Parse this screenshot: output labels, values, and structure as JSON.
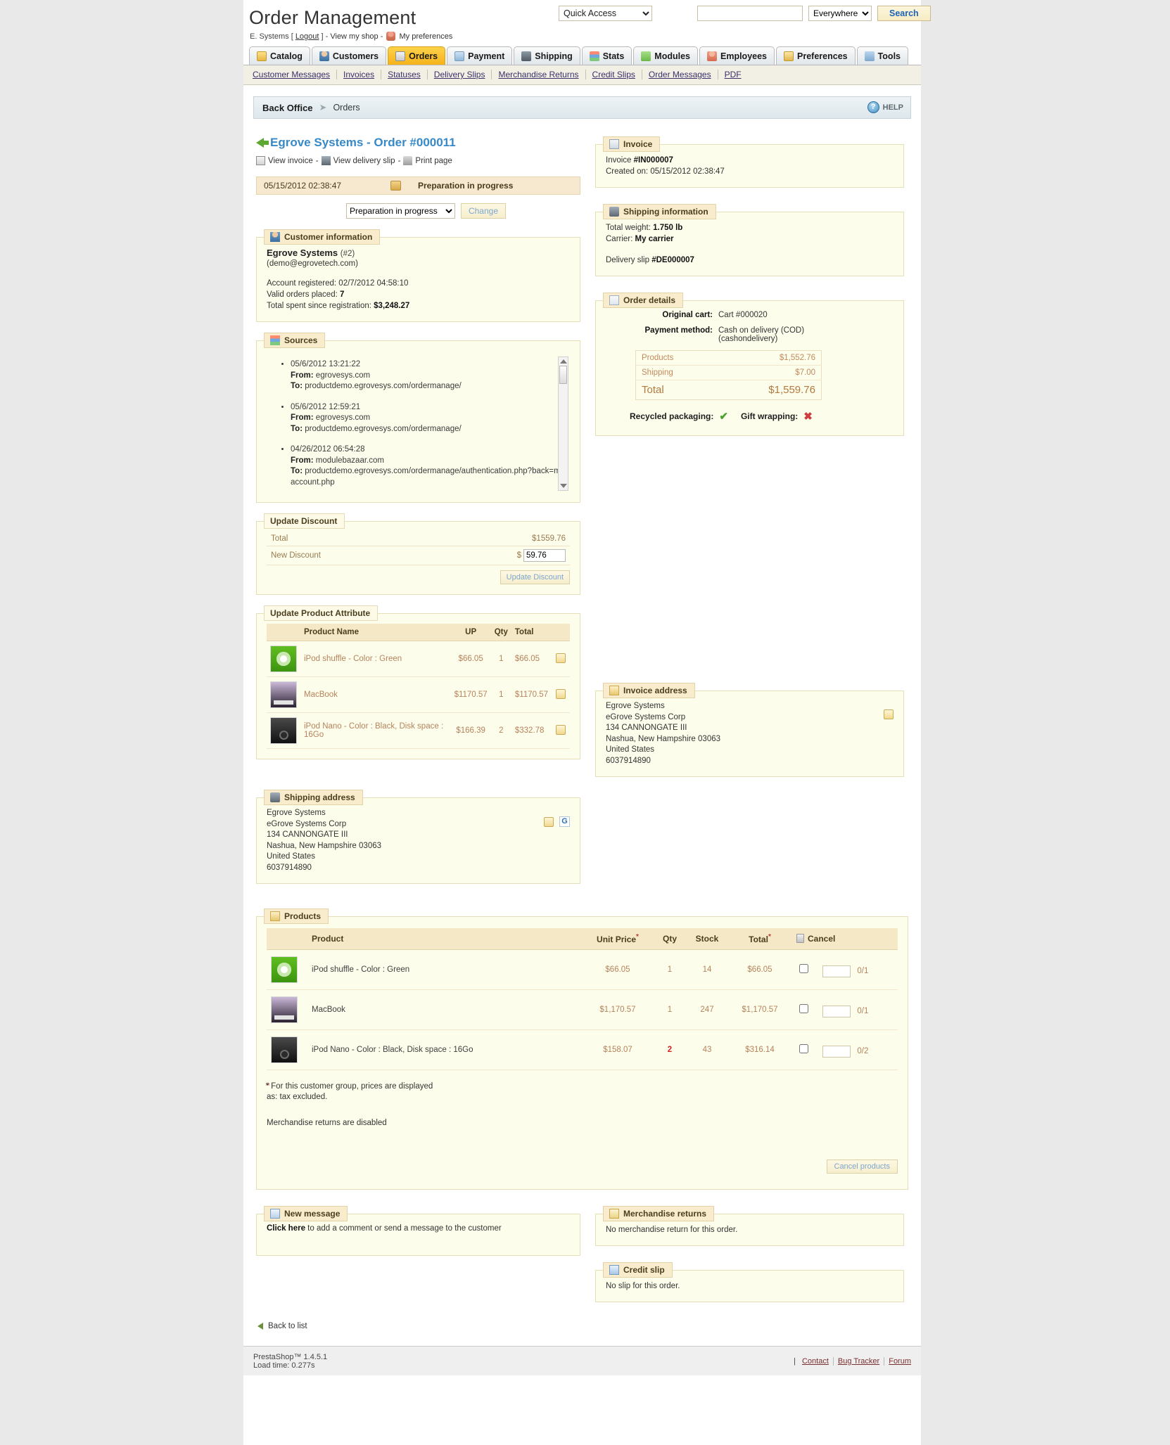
{
  "header": {
    "title": "Order Management",
    "user": "E. Systems",
    "logout": "Logout",
    "view_shop": "View my shop",
    "preferences": "My preferences",
    "quick_access": "Quick Access",
    "search_value": "",
    "search_scope": "Everywhere",
    "search_button": "Search"
  },
  "tabs": [
    {
      "label": "Catalog",
      "icon": "catalog-icon",
      "active": false
    },
    {
      "label": "Customers",
      "icon": "customers-icon",
      "active": false
    },
    {
      "label": "Orders",
      "icon": "orders-icon",
      "active": true
    },
    {
      "label": "Payment",
      "icon": "payment-icon",
      "active": false
    },
    {
      "label": "Shipping",
      "icon": "shipping-icon",
      "active": false
    },
    {
      "label": "Stats",
      "icon": "stats-icon",
      "active": false
    },
    {
      "label": "Modules",
      "icon": "modules-icon",
      "active": false
    },
    {
      "label": "Employees",
      "icon": "employees-icon",
      "active": false
    },
    {
      "label": "Preferences",
      "icon": "preferences-icon",
      "active": false
    },
    {
      "label": "Tools",
      "icon": "tools-icon",
      "active": false
    }
  ],
  "subnav": [
    "Customer Messages",
    "Invoices",
    "Statuses",
    "Delivery Slips",
    "Merchandise Returns",
    "Credit Slips",
    "Order Messages",
    "PDF"
  ],
  "breadcrumb": {
    "root": "Back Office",
    "current": "Orders",
    "help": "HELP"
  },
  "order": {
    "title": "Egrove Systems - Order #000011",
    "links": {
      "view_invoice": "View invoice",
      "view_delivery_slip": "View delivery slip",
      "print_page": "Print page",
      "sep": "-"
    },
    "status_date": "05/15/2012 02:38:47",
    "status_label": "Preparation in progress",
    "status_select": "Preparation in progress",
    "change_button": "Change"
  },
  "customer": {
    "legend": "Customer information",
    "name": "Egrove Systems",
    "id": "(#2)",
    "email": "(demo@egrovetech.com)",
    "registered_label": "Account registered:",
    "registered_value": "02/7/2012 04:58:10",
    "valid_orders_label": "Valid orders placed:",
    "valid_orders_value": "7",
    "total_spent_label": "Total spent since registration:",
    "total_spent_value": "$3,248.27"
  },
  "sources": {
    "legend": "Sources",
    "items": [
      {
        "date": "05/6/2012 13:21:22",
        "from_label": "From:",
        "from": "egrovesys.com",
        "to_label": "To:",
        "to": "productdemo.egrovesys.com/ordermanage/"
      },
      {
        "date": "05/6/2012 12:59:21",
        "from_label": "From:",
        "from": "egrovesys.com",
        "to_label": "To:",
        "to": "productdemo.egrovesys.com/ordermanage/"
      },
      {
        "date": "04/26/2012 06:54:28",
        "from_label": "From:",
        "from": "modulebazaar.com",
        "to_label": "To:",
        "to": "productdemo.egrovesys.com/ordermanage/authentication.php?back=my-account.php"
      }
    ]
  },
  "update_discount": {
    "legend": "Update Discount",
    "total_label": "Total",
    "total_value": "$1559.76",
    "new_discount_label": "New Discount",
    "currency": "$",
    "new_discount_value": "59.76",
    "button": "Update Discount"
  },
  "update_product_attribute": {
    "legend": "Update Product Attribute",
    "columns": [
      "Product Name",
      "UP",
      "Qty",
      "Total"
    ],
    "rows": [
      {
        "thumb": "ipod-shuffle-thumb",
        "name": "iPod shuffle - Color : Green",
        "up": "$66.05",
        "qty": "1",
        "total": "$66.05",
        "edit": "edit-icon"
      },
      {
        "thumb": "macbook-thumb",
        "name": "MacBook",
        "up": "$1170.57",
        "qty": "1",
        "total": "$1170.57",
        "edit": "edit-icon"
      },
      {
        "thumb": "ipod-nano-thumb",
        "name": "iPod Nano - Color : Black, Disk space : 16Go",
        "up": "$166.39",
        "qty": "2",
        "total": "$332.78",
        "edit": "edit-icon"
      }
    ]
  },
  "shipping_address": {
    "legend": "Shipping address",
    "lines": [
      "Egrove Systems",
      "eGrove Systems Corp",
      "134 CANNONGATE III",
      "Nashua, New Hampshire 03063",
      "United States",
      "6037914890"
    ],
    "edit_icon": "edit-icon",
    "map_icon": "google-map-icon"
  },
  "invoice_address": {
    "legend": "Invoice address",
    "lines": [
      "Egrove Systems",
      "eGrove Systems Corp",
      "134 CANNONGATE III",
      "Nashua, New Hampshire 03063",
      "United States",
      "6037914890"
    ],
    "edit_icon": "edit-icon"
  },
  "invoice": {
    "legend": "Invoice",
    "number_label": "Invoice",
    "number": "#IN000007",
    "created_label": "Created on:",
    "created_value": "05/15/2012 02:38:47"
  },
  "shipping_information": {
    "legend": "Shipping information",
    "weight_label": "Total weight:",
    "weight_value": "1.750 lb",
    "carrier_label": "Carrier:",
    "carrier_value": "My carrier",
    "delivery_slip_label": "Delivery slip",
    "delivery_slip_value": "#DE000007"
  },
  "order_details": {
    "legend": "Order details",
    "cart_label": "Original cart:",
    "cart_value": "Cart #000020",
    "payment_label": "Payment method:",
    "payment_value": "Cash on delivery (COD)",
    "payment_value2": "(cashondelivery)",
    "rows": [
      {
        "label": "Products",
        "value": "$1,552.76"
      },
      {
        "label": "Shipping",
        "value": "$7.00"
      }
    ],
    "total_label": "Total",
    "total_value": "$1,559.76",
    "recycled_label": "Recycled packaging:",
    "recycled_value": "yes",
    "gift_label": "Gift wrapping:",
    "gift_value": "no"
  },
  "products": {
    "legend": "Products",
    "columns": [
      "Product",
      "Unit Price",
      "Qty",
      "Stock",
      "Total",
      "Cancel"
    ],
    "unit_price_star": "*",
    "total_star": "*",
    "rows": [
      {
        "thumb": "ipod-shuffle-thumb",
        "name": "iPod shuffle - Color : Green",
        "unit_price": "$66.05",
        "qty": "1",
        "qty_red": false,
        "stock": "14",
        "total": "$66.05",
        "cancel_qty": "",
        "ratio": "0/1"
      },
      {
        "thumb": "macbook-thumb",
        "name": "MacBook",
        "unit_price": "$1,170.57",
        "qty": "1",
        "qty_red": false,
        "stock": "247",
        "total": "$1,170.57",
        "cancel_qty": "",
        "ratio": "0/1"
      },
      {
        "thumb": "ipod-nano-thumb",
        "name": "iPod Nano - Color : Black, Disk space : 16Go",
        "unit_price": "$158.07",
        "qty": "2",
        "qty_red": true,
        "stock": "43",
        "total": "$316.14",
        "cancel_qty": "",
        "ratio": "0/2"
      }
    ],
    "note_line1": "* For this customer group, prices are displayed",
    "note_line2": "as: tax excluded.",
    "returns_note": "Merchandise returns are disabled",
    "cancel_button": "Cancel products"
  },
  "new_message": {
    "legend": "New message",
    "link": "Click here",
    "rest": " to add a comment or send a message to the customer"
  },
  "merchandise_returns": {
    "legend": "Merchandise returns",
    "text": "No merchandise return for this order."
  },
  "credit_slip": {
    "legend": "Credit slip",
    "text": "No slip for this order."
  },
  "back_to_list": "Back to list",
  "footer": {
    "product": "PrestaShop™ 1.4.5.1",
    "load": "Load time: 0.277s",
    "links": [
      "Contact",
      "Bug Tracker",
      "Forum"
    ]
  }
}
